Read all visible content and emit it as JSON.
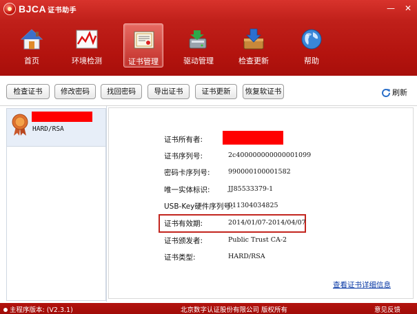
{
  "app": {
    "title": "BJCA",
    "subtitle": "证书助手",
    "minimize": "—",
    "close": "✕"
  },
  "nav": [
    {
      "label": "首页",
      "icon": "home-icon"
    },
    {
      "label": "环境检测",
      "icon": "chart-icon"
    },
    {
      "label": "证书管理",
      "icon": "certificate-icon",
      "active": true
    },
    {
      "label": "驱动管理",
      "icon": "driver-icon"
    },
    {
      "label": "检查更新",
      "icon": "update-icon"
    },
    {
      "label": "帮助",
      "icon": "globe-icon"
    }
  ],
  "toolbar": {
    "buttons": [
      "检查证书",
      "修改密码",
      "找回密码",
      "导出证书",
      "证书更新",
      "恢复软证书"
    ],
    "refresh": "刷新"
  },
  "cert_list": [
    {
      "type": "HARD/RSA"
    }
  ],
  "details": {
    "rows": [
      {
        "label": "证书所有者:",
        "value": ""
      },
      {
        "label": "证书序列号:",
        "value": "2c400000000000001099"
      },
      {
        "label": "密码卡序列号:",
        "value": "990000100001582"
      },
      {
        "label": "唯一实体标识:",
        "value": "JJ85533379-1"
      },
      {
        "label": "USB-Key硬件序列号:",
        "value": "011304034825"
      },
      {
        "label": "证书有效期:",
        "value": "2014/01/07-2014/04/07"
      },
      {
        "label": "证书颁发者:",
        "value": "Public Trust CA-2"
      },
      {
        "label": "证书类型:",
        "value": "HARD/RSA"
      }
    ],
    "detail_link": "查看证书详细信息"
  },
  "footer": {
    "version": "主程序版本: (V2.3.1)",
    "copyright": "北京数字认证股份有限公司 版权所有",
    "feedback": "意见反馈"
  },
  "colors": {
    "brand": "#b3130e",
    "highlight": "#c2241d",
    "link": "#0a3aa6",
    "redaction": "#ff0000"
  }
}
